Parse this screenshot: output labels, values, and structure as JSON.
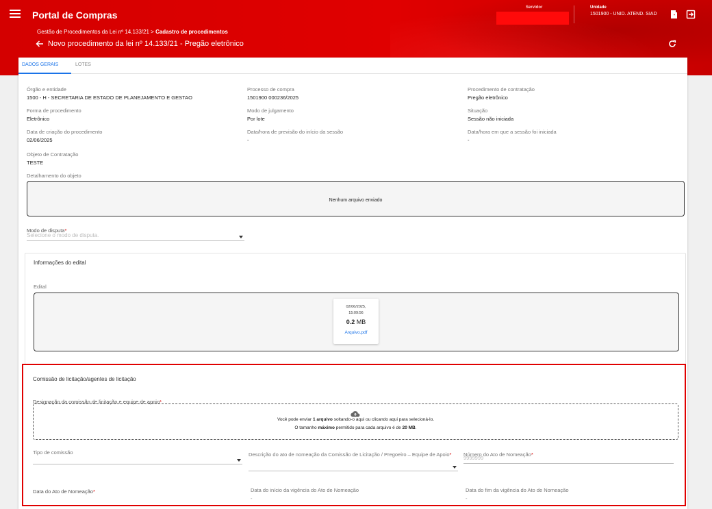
{
  "header": {
    "app_title": "Portal de Compras",
    "server_label": "Servidor",
    "unit_label": "Unidade",
    "unit_value": "1501900 - UNID. ATEND. SIAD",
    "breadcrumb_prefix": "Gestão de Procedimentos da Lei nº 14.133/21 >",
    "breadcrumb_current": "Cadastro de procedimentos",
    "page_title": "Novo procedimento da lei nº 14.133/21 - Pregão eletrônico"
  },
  "tabs": [
    {
      "label": "DADOS GERAIS",
      "active": true
    },
    {
      "label": "LOTES",
      "active": false
    }
  ],
  "fields": {
    "orgao": {
      "label": "Órgão e entidade",
      "value": "1500 - H - SECRETARIA DE ESTADO DE PLANEJAMENTO E GESTAO"
    },
    "processo": {
      "label": "Processo de compra",
      "value": "1501900 000236/2025"
    },
    "procedimento": {
      "label": "Procedimento de contratação",
      "value": "Pregão eletrônico"
    },
    "forma": {
      "label": "Forma de procedimento",
      "value": "Eletrônico"
    },
    "modo_julg": {
      "label": "Modo de julgamento",
      "value": "Por lote"
    },
    "situacao": {
      "label": "Situação",
      "value": "Sessão não iniciada"
    },
    "data_criacao": {
      "label": "Data de criação do procedimento",
      "value": "02/06/2025"
    },
    "previsao": {
      "label": "Data/hora de previsão do início da sessão",
      "value": "-"
    },
    "iniciada": {
      "label": "Data/hora em que a sessão foi iniciada",
      "value": "-"
    },
    "objeto": {
      "label": "Objeto de Contratação",
      "value": "TESTE"
    },
    "detalhamento": {
      "label": "Detalhamento do objeto",
      "empty_text": "Nenhum arquivo enviado"
    }
  },
  "modo_disputa": {
    "label": "Modo de disputa",
    "required": "*",
    "placeholder": "Selecione o modo de disputa."
  },
  "edital": {
    "title": "Informações do edital",
    "label": "Edital",
    "file": {
      "date": "02/06/2025,",
      "time": "15:09:56",
      "size_num": "0.2",
      "size_unit": "MB",
      "name": "Arquivo.pdf"
    }
  },
  "comissao": {
    "title": "Comissão de licitação/agentes de licitação",
    "designacao_label": "Designação da comissão de licitação e equipe de apoio",
    "required": "*",
    "upload": {
      "l1_a": "Você pode enviar ",
      "l1_b": "1 arquivo",
      "l1_c": " soltando-o aqui ou clicando aqui para selecioná-lo.",
      "l2_a": "O tamanho ",
      "l2_b": "máximo",
      "l2_c": " permitido para cada arquivo é de ",
      "l2_d": "20 MB",
      "l2_e": "."
    },
    "tipo_label": "Tipo de comissão",
    "descricao_label": "Descrição do ato de nomeação da Comissão de Licitação / Pregoeiro – Equipe de Apoio",
    "numero_label": "Número do Ato de Nomeação",
    "numero_placeholder": "9999999",
    "data_ato_label": "Data do Ato de Nomeação",
    "inicio_label": "Data do início da vigência do Ato de Nomeação",
    "inicio_value": "-",
    "fim_label": "Data do fim da vigência do Ato de Nomeação",
    "fim_value": "-"
  },
  "colors": {
    "brand": "#d40000",
    "accent": "#1a73e8",
    "highlight": "#e00000"
  },
  "icons": [
    "menu-icon",
    "door-icon",
    "logout-icon",
    "refresh-icon",
    "arrow-back-icon",
    "cloud-upload-icon",
    "caret-down-icon"
  ]
}
